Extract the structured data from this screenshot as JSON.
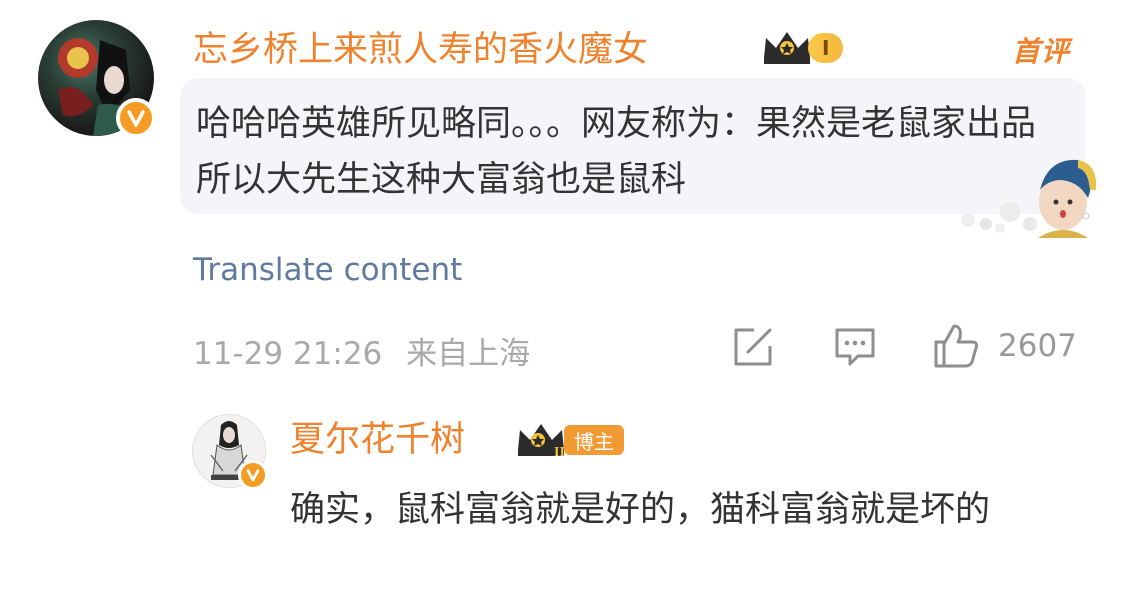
{
  "comment": {
    "username": "忘乡桥上来煎人寿的香火魔女",
    "level_label": "I",
    "tag": "首评",
    "text": "哈哈哈英雄所见略同。。。网友称为：果然是老鼠家出品 所以大先生这种大富翁也是鼠科",
    "translate": "Translate content",
    "timestamp": "11-29 21:26",
    "location": "来自上海",
    "like_count": "2607"
  },
  "reply": {
    "username": "夏尔花千树",
    "badge_label": "博主",
    "level_label": "II",
    "text": "确实，鼠科富翁就是好的，猫科富翁就是坏的"
  },
  "colors": {
    "username": "#f0822e",
    "link": "#5f7aa1",
    "meta": "#a9a9a9",
    "bubble": "#f5f4f8"
  }
}
